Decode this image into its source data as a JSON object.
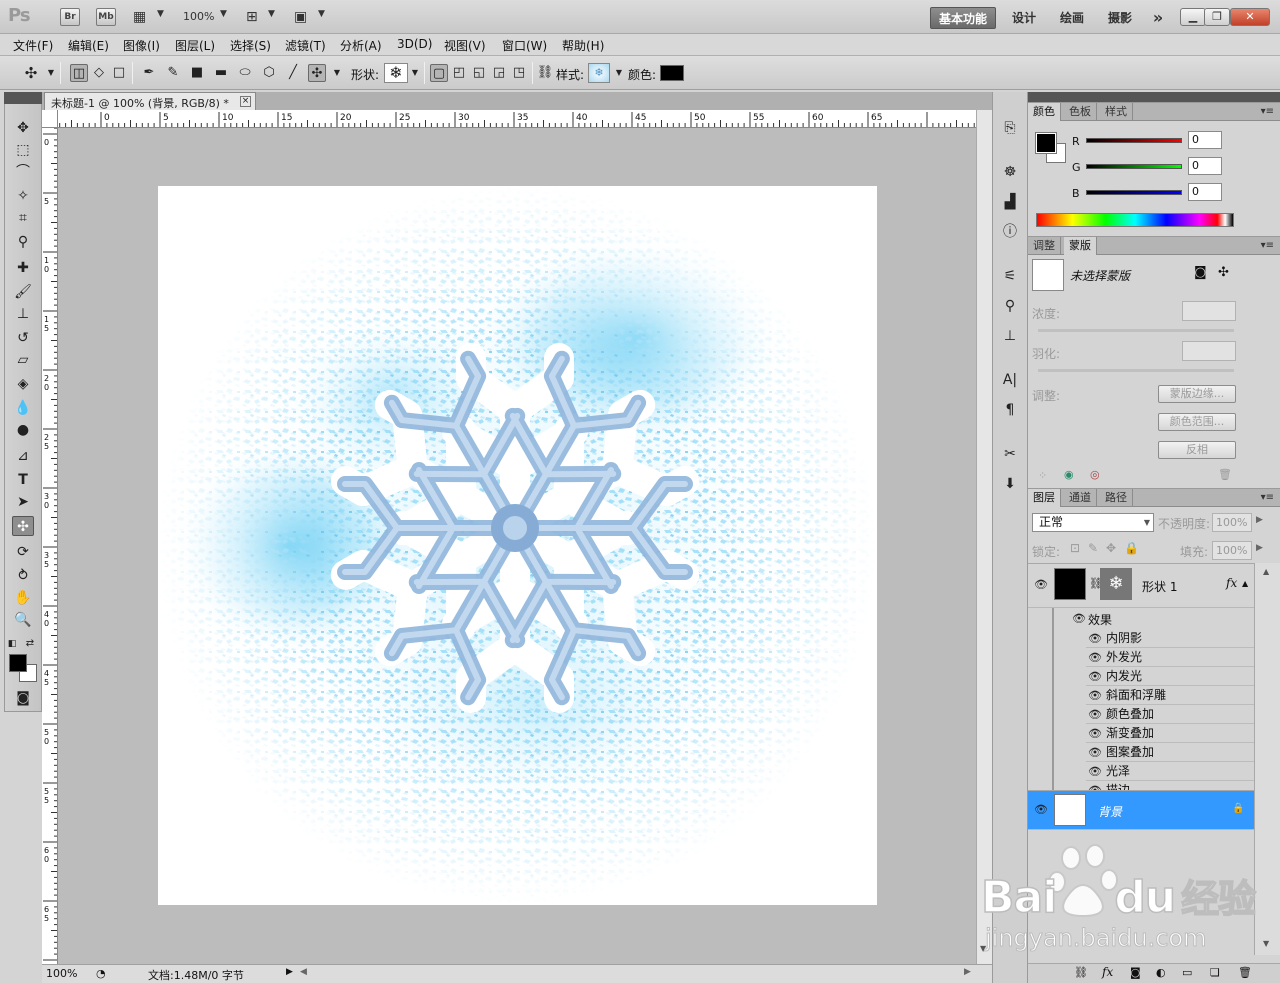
{
  "titlebar": {
    "logo": "Ps",
    "bridge": "Br",
    "minibridge": "Mb",
    "zoom": "100%",
    "workspaces": [
      "基本功能",
      "设计",
      "绘画",
      "摄影"
    ],
    "more": "»"
  },
  "menu": [
    "文件(F)",
    "编辑(E)",
    "图像(I)",
    "图层(L)",
    "选择(S)",
    "滤镜(T)",
    "分析(A)",
    "3D(D)",
    "视图(V)",
    "窗口(W)",
    "帮助(H)"
  ],
  "options": {
    "shape_label": "形状:",
    "style_label": "样式:",
    "color_label": "颜色:",
    "color_value": "#000000"
  },
  "document": {
    "tab_title": "未标题-1 @ 100% (背景, RGB/8) *",
    "close": "×",
    "ruler_h": [
      "5",
      "0",
      "5",
      "10",
      "15",
      "20",
      "25",
      "30",
      "35",
      "40",
      "45",
      "50",
      "55",
      "60",
      "65"
    ],
    "ruler_v": [
      "5",
      "0",
      "5",
      "1\n0",
      "1\n5",
      "2\n0",
      "2\n5",
      "3\n0",
      "3\n5",
      "4\n0",
      "4\n5",
      "5\n0",
      "5\n5",
      "6\n0",
      "6\n5"
    ]
  },
  "status": {
    "zoom": "100%",
    "doc_info": "文档:1.48M/0 字节"
  },
  "color_panel": {
    "tabs": [
      "颜色",
      "色板",
      "样式"
    ],
    "labels": [
      "R",
      "G",
      "B"
    ],
    "values": [
      "0",
      "0",
      "0"
    ]
  },
  "mask_panel": {
    "tabs": [
      "调整",
      "蒙版"
    ],
    "no_selection": "未选择蒙版",
    "density_label": "浓度:",
    "feather_label": "羽化:",
    "refine_label": "调整:",
    "buttons": [
      "蒙版边缘...",
      "颜色范围...",
      "反相"
    ]
  },
  "layers_panel": {
    "tabs": [
      "图层",
      "通道",
      "路径"
    ],
    "blend_mode": "正常",
    "opacity_label": "不透明度:",
    "opacity_value": "100%",
    "lock_label": "锁定:",
    "fill_label": "填充:",
    "fill_value": "100%",
    "shape_layer_name": "形状 1",
    "fx": "fx",
    "effects_label": "效果",
    "effects": [
      "内阴影",
      "外发光",
      "内发光",
      "斜面和浮雕",
      "颜色叠加",
      "渐变叠加",
      "图案叠加",
      "光泽",
      "描边"
    ],
    "background_layer_name": "背景"
  },
  "watermark": {
    "brand": "Bai",
    "brand_du": "du",
    "brand_cn": "经验",
    "url": "jingyan.baidu.com"
  },
  "colors": {
    "selected_layer": "#3399ff",
    "frost_light": "#bfeaff",
    "frost_deep": "#6cd0f5",
    "flake": "#8fb5dc"
  }
}
